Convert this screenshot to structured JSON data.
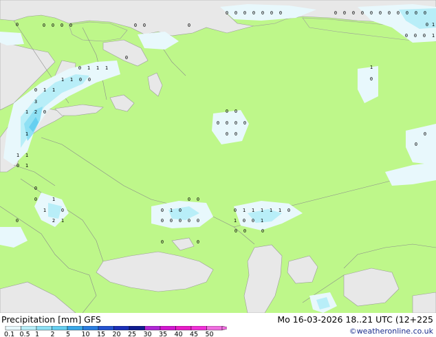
{
  "footer": {
    "title": "Precipitation [mm]  GFS",
    "valid": "Mo 16-03-2026 18..21 UTC (12+225",
    "credit": "©weatheronline.co.uk"
  },
  "legend": {
    "ticks": [
      "0.1",
      "0.5",
      "1",
      "2",
      "5",
      "10",
      "15",
      "20",
      "25",
      "30",
      "35",
      "40",
      "45",
      "50"
    ],
    "colors": [
      "#e8f8fc",
      "#b8eef8",
      "#8ee0f4",
      "#66cff0",
      "#3aa8e8",
      "#2a7de0",
      "#2453d0",
      "#1b30b8",
      "#101c90",
      "#b026d6",
      "#d216d0",
      "#e81cc8",
      "#f030d8",
      "#f06ee0"
    ]
  },
  "precip_values": [
    {
      "v": "0"
    },
    {
      "v": "0"
    },
    {
      "v": "0"
    },
    {
      "v": "0"
    },
    {
      "v": "0"
    },
    {
      "v": "0"
    },
    {
      "v": "0"
    },
    {
      "v": "0"
    },
    {
      "v": "0"
    },
    {
      "v": "0"
    },
    {
      "v": "0"
    },
    {
      "v": "0"
    },
    {
      "v": "0"
    },
    {
      "v": "0"
    },
    {
      "v": "0"
    },
    {
      "v": "0"
    },
    {
      "v": "0"
    },
    {
      "v": "0"
    },
    {
      "v": "0"
    },
    {
      "v": "0"
    },
    {
      "v": "0"
    },
    {
      "v": "1"
    },
    {
      "v": "0"
    },
    {
      "v": "1"
    },
    {
      "v": "0"
    },
    {
      "v": "0"
    },
    {
      "v": "0"
    },
    {
      "v": "0"
    },
    {
      "v": "0"
    },
    {
      "v": "0"
    },
    {
      "v": "0"
    },
    {
      "v": "0"
    },
    {
      "v": "1"
    },
    {
      "v": "1"
    },
    {
      "v": "1"
    },
    {
      "v": "0"
    },
    {
      "v": "1"
    },
    {
      "v": "1"
    },
    {
      "v": "0"
    },
    {
      "v": "0"
    },
    {
      "v": "0"
    },
    {
      "v": "1"
    },
    {
      "v": "1"
    },
    {
      "v": "0"
    },
    {
      "v": "3"
    },
    {
      "v": "1"
    },
    {
      "v": "2"
    },
    {
      "v": "0"
    },
    {
      "v": "1"
    },
    {
      "v": "1"
    },
    {
      "v": "1"
    },
    {
      "v": "1"
    },
    {
      "v": "0"
    },
    {
      "v": "0"
    },
    {
      "v": "0"
    },
    {
      "v": "0"
    },
    {
      "v": "0"
    },
    {
      "v": "0"
    },
    {
      "v": "0"
    },
    {
      "v": "0"
    },
    {
      "v": "0"
    },
    {
      "v": "0"
    },
    {
      "v": "0"
    },
    {
      "v": "1"
    },
    {
      "v": "0"
    },
    {
      "v": "2"
    },
    {
      "v": "1"
    },
    {
      "v": "0"
    },
    {
      "v": "1"
    },
    {
      "v": "0"
    },
    {
      "v": "1"
    },
    {
      "v": "0"
    },
    {
      "v": "0"
    },
    {
      "v": "0"
    },
    {
      "v": "0"
    },
    {
      "v": "0"
    },
    {
      "v": "0"
    },
    {
      "v": "0"
    },
    {
      "v": "0"
    },
    {
      "v": "0"
    },
    {
      "v": "1"
    },
    {
      "v": "1"
    },
    {
      "v": "1"
    },
    {
      "v": "1"
    },
    {
      "v": "1"
    },
    {
      "v": "0"
    },
    {
      "v": "1"
    },
    {
      "v": "0"
    },
    {
      "v": "0"
    },
    {
      "v": "1"
    },
    {
      "v": "0"
    },
    {
      "v": "0"
    },
    {
      "v": "0"
    },
    {
      "v": "0"
    },
    {
      "v": "0"
    },
    {
      "v": "1"
    },
    {
      "v": "0"
    },
    {
      "v": "0"
    },
    {
      "v": "0"
    }
  ]
}
